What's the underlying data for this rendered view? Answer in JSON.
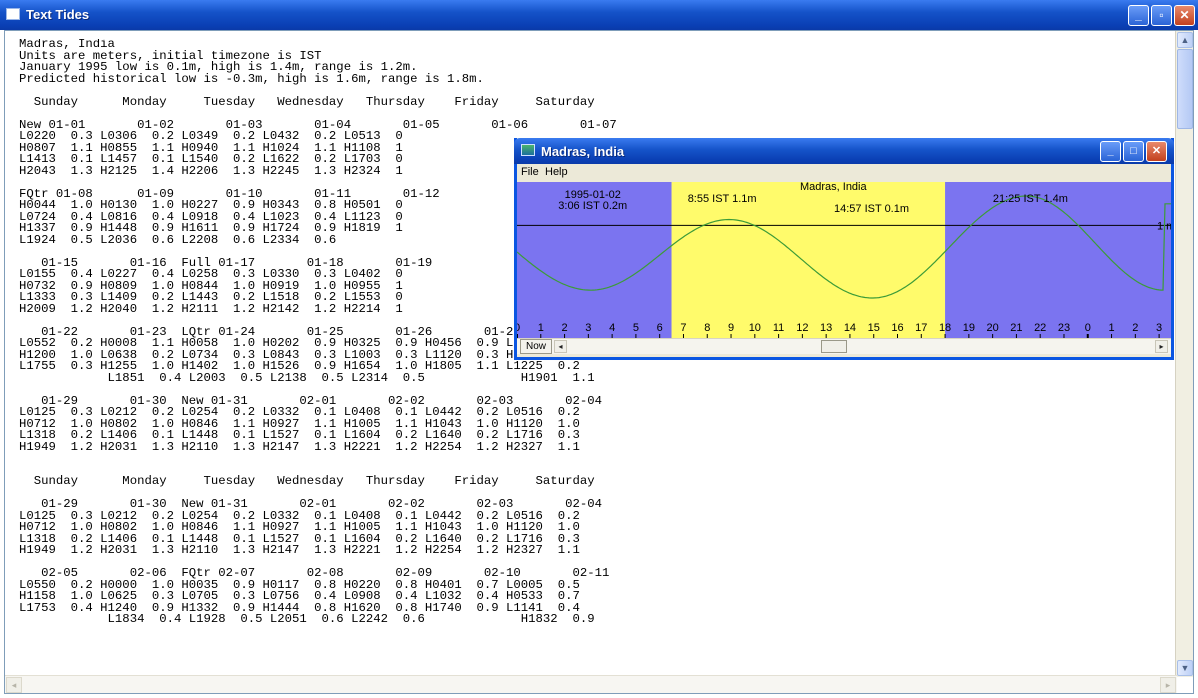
{
  "window": {
    "title": "Text Tides",
    "minimize": "_",
    "maximize": "▫",
    "close": "✕"
  },
  "text_lines": [
    "Madras, India",
    "Units are meters, initial timezone is IST",
    "January 1995 low is 0.1m, high is 1.4m, range is 1.2m.",
    "Predicted historical low is -0.3m, high is 1.6m, range is 1.8m.",
    "",
    "  Sunday      Monday     Tuesday   Wednesday   Thursday    Friday     Saturday",
    "",
    "New 01-01       01-02       01-03       01-04       01-05       01-06       01-07",
    "L0220  0.3 L0306  0.2 L0349  0.2 L0432  0.2 L0513  0",
    "H0807  1.1 H0855  1.1 H0940  1.1 H1024  1.1 H1108  1",
    "L1413  0.1 L1457  0.1 L1540  0.2 L1622  0.2 L1703  0",
    "H2043  1.3 H2125  1.4 H2206  1.3 H2245  1.3 H2324  1",
    "",
    "FQtr 01-08      01-09       01-10       01-11       01-12",
    "H0044  1.0 H0130  1.0 H0227  0.9 H0343  0.8 H0501  0",
    "L0724  0.4 L0816  0.4 L0918  0.4 L1023  0.4 L1123  0",
    "H1337  0.9 H1448  0.9 H1611  0.9 H1724  0.9 H1819  1",
    "L1924  0.5 L2036  0.6 L2208  0.6 L2334  0.6",
    "",
    "   01-15       01-16  Full 01-17       01-18       01-19",
    "L0155  0.4 L0227  0.4 L0258  0.3 L0330  0.3 L0402  0",
    "H0732  0.9 H0809  1.0 H0844  1.0 H0919  1.0 H0955  1",
    "L1333  0.3 L1409  0.2 L1443  0.2 L1518  0.2 L1553  0",
    "H2009  1.2 H2040  1.2 H2111  1.2 H2142  1.2 H2214  1",
    "",
    "   01-22       01-23  LQtr 01-24       01-25       01-26       01-27       01-28",
    "L0552  0.2 H0008  1.1 H0058  1.0 H0202  0.9 H0325  0.9 H0456  0.9 L0028  0.4",
    "H1200  1.0 L0638  0.2 L0734  0.3 L0843  0.3 L1003  0.3 L1120  0.3 H0612  0.9",
    "L1755  0.3 H1255  1.0 H1402  1.0 H1526  0.9 H1654  1.0 H1805  1.1 L1225  0.2",
    "            L1851  0.4 L2003  0.5 L2138  0.5 L2314  0.5             H1901  1.1",
    "",
    "   01-29       01-30  New 01-31       02-01       02-02       02-03       02-04",
    "L0125  0.3 L0212  0.2 L0254  0.2 L0332  0.1 L0408  0.1 L0442  0.2 L0516  0.2",
    "H0712  1.0 H0802  1.0 H0846  1.1 H0927  1.1 H1005  1.1 H1043  1.0 H1120  1.0",
    "L1318  0.2 L1406  0.1 L1448  0.1 L1527  0.1 L1604  0.2 L1640  0.2 L1716  0.3",
    "H1949  1.2 H2031  1.3 H2110  1.3 H2147  1.3 H2221  1.2 H2254  1.2 H2327  1.1",
    "",
    "",
    "  Sunday      Monday     Tuesday   Wednesday   Thursday    Friday     Saturday",
    "",
    "   01-29       01-30  New 01-31       02-01       02-02       02-03       02-04",
    "L0125  0.3 L0212  0.2 L0254  0.2 L0332  0.1 L0408  0.1 L0442  0.2 L0516  0.2",
    "H0712  1.0 H0802  1.0 H0846  1.1 H0927  1.1 H1005  1.1 H1043  1.0 H1120  1.0",
    "L1318  0.2 L1406  0.1 L1448  0.1 L1527  0.1 L1604  0.2 L1640  0.2 L1716  0.3",
    "H1949  1.2 H2031  1.3 H2110  1.3 H2147  1.3 H2221  1.2 H2254  1.2 H2327  1.1",
    "",
    "   02-05       02-06  FQtr 02-07       02-08       02-09       02-10       02-11",
    "L0550  0.2 H0000  1.0 H0035  0.9 H0117  0.8 H0220  0.8 H0401  0.7 L0005  0.5",
    "H1158  1.0 L0625  0.3 L0705  0.3 L0756  0.4 L0908  0.4 L1032  0.4 H0533  0.7",
    "L1753  0.4 H1240  0.9 H1332  0.9 H1444  0.8 H1620  0.8 H1740  0.9 L1141  0.4",
    "            L1834  0.4 L1928  0.5 L2051  0.6 L2242  0.6             H1832  0.9"
  ],
  "popup": {
    "title": "Madras, India",
    "menu": [
      "File",
      "Help"
    ],
    "now_label": "Now",
    "left_arrow": "◂",
    "right_arrow": "▸",
    "minimize": "_",
    "maximize": "□",
    "close": "✕"
  },
  "chart_data": {
    "type": "line",
    "title": "Madras, India",
    "date_label": "1995-01-02",
    "reference_label": "1 m",
    "annotations": [
      {
        "text": "3:06 IST 0.2m",
        "hour": 3.1,
        "value": 0.2
      },
      {
        "text": "8:55 IST 1.1m",
        "hour": 8.92,
        "value": 1.1
      },
      {
        "text": "14:57 IST 0.1m",
        "hour": 14.95,
        "value": 0.1
      },
      {
        "text": "21:25 IST 1.4m",
        "hour": 21.42,
        "value": 1.4
      }
    ],
    "x_ticks": [
      "0",
      "1",
      "2",
      "3",
      "4",
      "5",
      "6",
      "7",
      "8",
      "9",
      "10",
      "11",
      "12",
      "13",
      "14",
      "15",
      "16",
      "17",
      "18",
      "19",
      "20",
      "21",
      "22",
      "23",
      "0",
      "1",
      "2",
      "3"
    ],
    "daylight_start": 6.5,
    "daylight_end": 18.0,
    "x_range": [
      0,
      27.5
    ],
    "tide_points": [
      [
        -3.6,
        1.3
      ],
      [
        3.1,
        0.2
      ],
      [
        8.92,
        1.1
      ],
      [
        14.95,
        0.1
      ],
      [
        21.42,
        1.4
      ],
      [
        27.2,
        0.2
      ]
    ],
    "colors": {
      "night": "#7b74f0",
      "day": "#fffb6b",
      "curve": "#3c9b38",
      "ref_line": "#000000"
    }
  }
}
